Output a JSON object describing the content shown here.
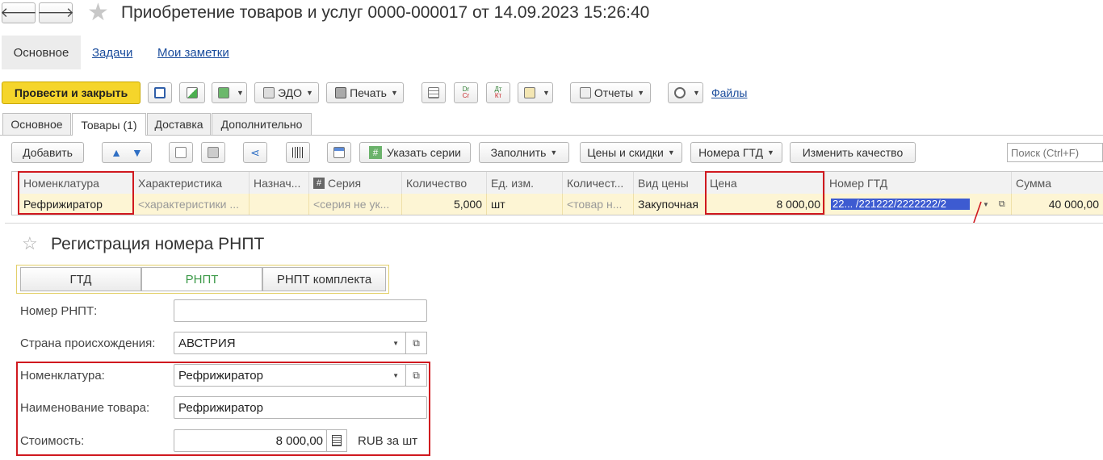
{
  "window": {
    "title": "Приобретение товаров и услуг 0000-000017 от 14.09.2023 15:26:40",
    "back": "🡐",
    "forward": "🡒"
  },
  "sections": {
    "main": "Основное",
    "tasks": "Задачи",
    "notes": "Мои заметки"
  },
  "toolbar": {
    "post_close": "Провести и закрыть",
    "edo": "ЭДО",
    "print": "Печать",
    "dt_label": "Dr",
    "ct_label": "Cr",
    "dt2_label": "Дт",
    "kt_label": "Кт",
    "reports": "Отчеты",
    "files": "Файлы"
  },
  "tabs": [
    {
      "label": "Основное"
    },
    {
      "label": "Товары (1)"
    },
    {
      "label": "Доставка"
    },
    {
      "label": "Дополнительно"
    }
  ],
  "table_toolbar": {
    "add": "Добавить",
    "series_sign": "#",
    "series": "Указать серии",
    "fill": "Заполнить",
    "prices": "Цены и скидки",
    "gtd": "Номера ГТД",
    "quality": "Изменить качество",
    "search_placeholder": "Поиск (Ctrl+F)"
  },
  "table": {
    "columns": [
      "Номенклатура",
      "Характеристика",
      "Назнач...",
      "Серия",
      "Количество",
      "Ед. изм.",
      "Количест...",
      "Вид цены",
      "Цена",
      "Номер ГТД",
      "Сумма"
    ],
    "row": {
      "item": "Рефрижиратор",
      "characteristic": "<характеристики ...",
      "purpose": "",
      "series": "<серия не ук...",
      "quantity": "5,000",
      "unit": "шт",
      "qty2": "<товар н...",
      "price_type": "Закупочная",
      "price": "8 000,00",
      "gtd_prefix": "22...",
      "gtd_number": "/221222/2222222/2",
      "sum": "40 000,00"
    }
  },
  "dialog": {
    "title": "Регистрация номера РНПТ",
    "star": "☆",
    "modes": [
      "ГТД",
      "РНПТ",
      "РНПТ комплекта"
    ],
    "rnpt_label": "Номер РНПТ:",
    "rnpt_value": "",
    "country_label": "Страна происхождения:",
    "country_value": "АВСТРИЯ",
    "nomenclature_label": "Номенклатура:",
    "nomenclature_value": "Рефрижиратор",
    "name_label": "Наименование товара:",
    "name_value": "Рефрижиратор",
    "cost_label": "Стоимость:",
    "cost_value": "8 000,00",
    "cost_unit": "RUB за шт"
  },
  "colors": {
    "primary": "#f5d52b",
    "link": "#1a4c9c",
    "highlight": "#d0191f",
    "row": "#fdf5d4",
    "selection": "#3d5bd1"
  }
}
